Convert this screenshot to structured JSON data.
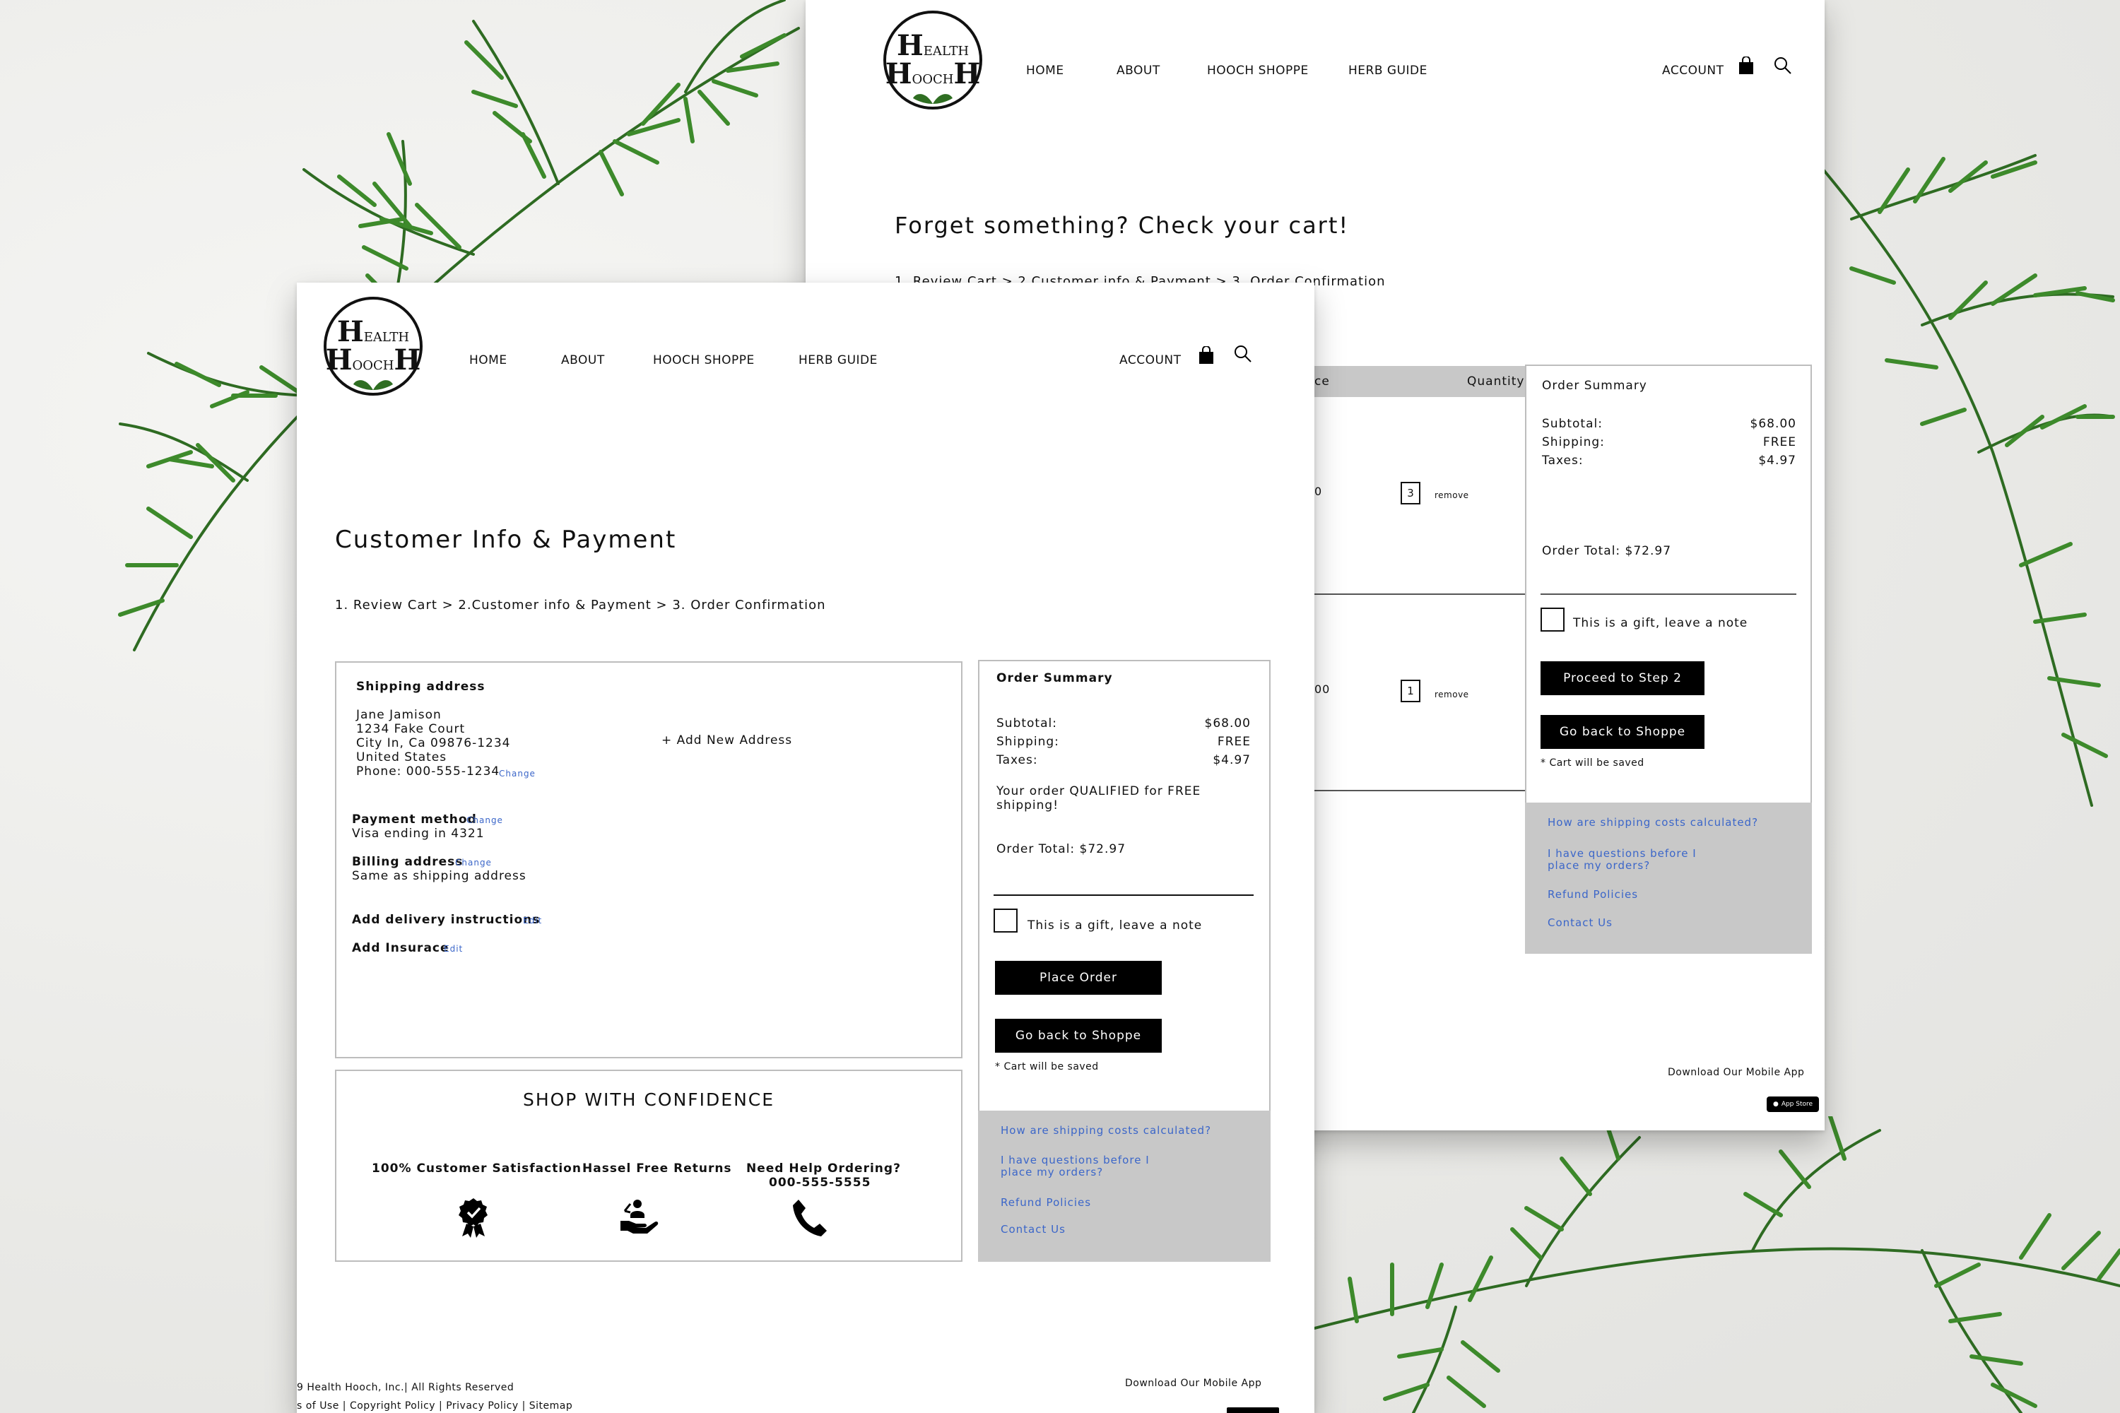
{
  "brand": {
    "logo_line1_big": "H",
    "logo_line1_small": "EALTH",
    "logo_line2_small": "OOCH",
    "logo_line2_big_left": "H",
    "logo_line2_big_right": "H"
  },
  "nav": {
    "home": "HOME",
    "about": "ABOUT",
    "shoppe": "HOOCH SHOPPE",
    "guide": "HERB GUIDE",
    "account": "ACCOUNT",
    "cart_icon": "shopping-bag-icon",
    "search_icon": "search-icon"
  },
  "back_page": {
    "title": "Forget something? Check your cart!",
    "breadcrumb": "1. Review Cart > 2.Customer info & Payment > 3. Order Confirmation",
    "table_header": {
      "price_partial": "ce",
      "quantity": "Quantity"
    },
    "rows": [
      {
        "price_partial": "0",
        "qty": "3",
        "remove": "remove"
      },
      {
        "price_partial": "00",
        "qty": "1",
        "remove": "remove"
      }
    ],
    "summary": {
      "heading": "Order Summary",
      "subtotal_label": "Subtotal:",
      "subtotal_value": "$68.00",
      "shipping_label": "Shipping:",
      "shipping_value": "FREE",
      "taxes_label": "Taxes:",
      "taxes_value": "$4.97",
      "total": "Order Total: $72.97",
      "gift": "This is a gift, leave a note",
      "primary_button": "Proceed to Step 2",
      "secondary_button": "Go back to Shoppe",
      "note": "* Cart will be saved"
    },
    "faq": [
      "How are shipping costs calculated?",
      "I have questions before I place my orders?",
      "Refund Policies",
      "Contact Us"
    ],
    "download_app": "Download Our Mobile App",
    "app_store": "App Store"
  },
  "front_page": {
    "title": "Customer Info & Payment",
    "breadcrumb": "1. Review Cart > 2.Customer info & Payment > 3. Order Confirmation",
    "shipping": {
      "heading": "Shipping address",
      "name": "Jane Jamison",
      "street": "1234 Fake Court",
      "city": "City In, Ca 09876-1234",
      "country": "United States",
      "phone": "Phone: 000-555-1234",
      "change": "Change",
      "add_new": "+ Add New Address"
    },
    "payment": {
      "heading": "Payment method",
      "change": "Change",
      "value": "Visa ending in 4321"
    },
    "billing": {
      "heading": "Billing address",
      "change": "Change",
      "value": "Same as shipping address"
    },
    "delivery": {
      "heading": "Add delivery instructions",
      "edit": "Edit"
    },
    "insurance": {
      "heading": "Add Insurace",
      "edit": "Edit"
    },
    "confidence": {
      "heading": "SHOP WITH CONFIDENCE",
      "items": [
        {
          "label": "100% Customer Satisfaction",
          "icon": "award-badge-icon"
        },
        {
          "label": "Hassel Free Returns",
          "icon": "hand-returns-icon"
        },
        {
          "label": "Need Help Ordering?",
          "sub": "000-555-5555",
          "icon": "phone-icon"
        }
      ]
    },
    "summary": {
      "heading": "Order Summary",
      "subtotal_label": "Subtotal:",
      "subtotal_value": "$68.00",
      "shipping_label": "Shipping:",
      "shipping_value": "FREE",
      "taxes_label": "Taxes:",
      "taxes_value": "$4.97",
      "qualified": "Your order QUALIFIED for FREE shipping!",
      "total": "Order Total: $72.97",
      "gift": "This is a gift, leave a note",
      "primary_button": "Place Order",
      "secondary_button": "Go back to Shoppe",
      "note": "* Cart will be saved"
    },
    "faq": [
      "How are shipping costs calculated?",
      "I have questions before I place my orders?",
      "Refund Policies",
      "Contact Us"
    ],
    "footer": {
      "copyright": "9 Health Hooch, Inc.|  All Rights Reserved",
      "links": "s of Use | Copyright Policy | Privacy Policy | Sitemap",
      "download_app": "Download Our Mobile App"
    }
  },
  "colors": {
    "accent_link": "#3b66c9",
    "button_bg": "#000000",
    "faq_bg": "#c8c8c8",
    "herb_green": "#2f7a24"
  }
}
